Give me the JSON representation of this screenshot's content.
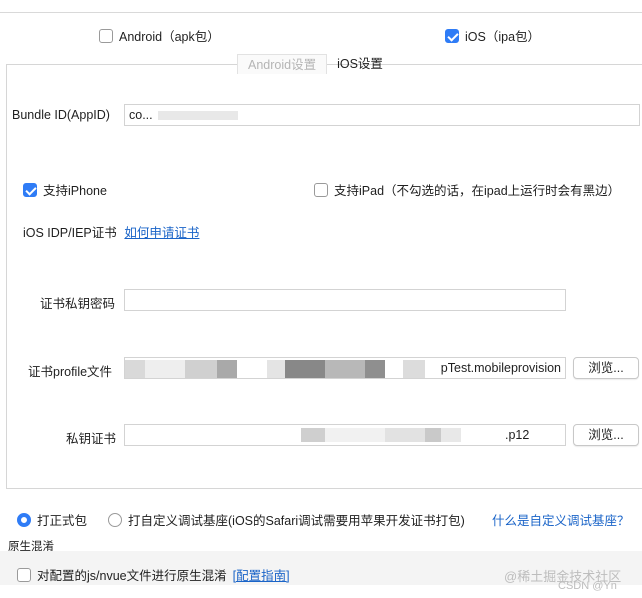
{
  "package_type": {
    "android_label": "Android（apk包）",
    "android_checked": false,
    "ios_label": "iOS（ipa包）",
    "ios_checked": true
  },
  "tabs": [
    {
      "label": "Android设置",
      "active": false
    },
    {
      "label": "iOS设置",
      "active": true
    }
  ],
  "ios_settings": {
    "bundle_id_label": "Bundle ID(AppID)",
    "bundle_id_value": "co...",
    "support_iphone_label": "支持iPhone",
    "support_iphone_checked": true,
    "support_ipad_label": "支持iPad（不勾选的话，在ipad上运行时会有黑边）",
    "support_ipad_checked": false,
    "cert_label": "iOS IDP/IEP证书",
    "cert_help_link": "如何申请证书",
    "cert_password_label": "证书私钥密码",
    "cert_password_value": "",
    "profile_label": "证书profile文件",
    "profile_value_suffix": "pTest.mobileprovision",
    "private_key_label": "私钥证书",
    "private_key_value_suffix": ".p12",
    "browse_label": "浏览..."
  },
  "build_mode": {
    "formal_label": "打正式包",
    "formal_checked": true,
    "custom_label": "打自定义调试基座(iOS的Safari调试需要用苹果开发证书打包)",
    "custom_checked": false,
    "custom_help_link": "什么是自定义调试基座？"
  },
  "obfuscation": {
    "title": "原生混淆",
    "option_label": "对配置的js/nvue文件进行原生混淆",
    "option_checked": false,
    "guide_link": "[配置指南]"
  },
  "watermark": {
    "line1": "@稀土掘金技术社区",
    "line2": "CSDN @Yn"
  },
  "colors": {
    "accent": "#2f7cf6",
    "link": "#1a64c8"
  }
}
